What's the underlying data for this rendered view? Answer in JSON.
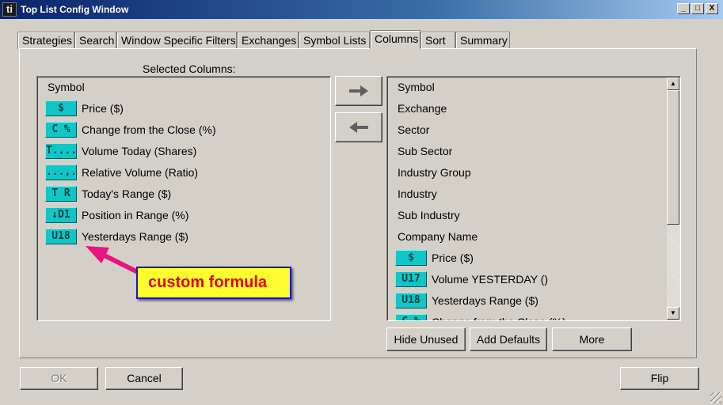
{
  "window": {
    "title": "Top List Config Window",
    "app_icon_text": "ti",
    "controls": {
      "minimize": "_",
      "maximize": "□",
      "close": "X"
    }
  },
  "tabs": [
    {
      "label": "Strategies"
    },
    {
      "label": "Search"
    },
    {
      "label": "Window Specific Filters"
    },
    {
      "label": "Exchanges"
    },
    {
      "label": "Symbol Lists"
    },
    {
      "label": "Columns",
      "active": true
    },
    {
      "label": "Sort"
    },
    {
      "label": "Summary"
    }
  ],
  "selected_columns": {
    "label": "Selected Columns:",
    "items": [
      {
        "icon": "",
        "label": "Symbol"
      },
      {
        "icon": "$",
        "label": "Price ($)"
      },
      {
        "icon": "C %",
        "label": "Change from the Close (%)"
      },
      {
        "icon": "T....l",
        "label": "Volume Today (Shares)"
      },
      {
        "icon": "...,.l|",
        "label": "Relative Volume (Ratio)"
      },
      {
        "icon": "T R",
        "label": "Today's Range ($)"
      },
      {
        "icon": "↓D1",
        "label": "Position in Range (%)"
      },
      {
        "icon": "U18",
        "label": "Yesterdays Range ($)"
      }
    ]
  },
  "available_columns": {
    "items": [
      {
        "icon": "",
        "label": "Symbol"
      },
      {
        "icon": "",
        "label": "Exchange"
      },
      {
        "icon": "",
        "label": "Sector"
      },
      {
        "icon": "",
        "label": "Sub Sector"
      },
      {
        "icon": "",
        "label": "Industry Group"
      },
      {
        "icon": "",
        "label": "Industry"
      },
      {
        "icon": "",
        "label": "Sub Industry"
      },
      {
        "icon": "",
        "label": "Company Name"
      },
      {
        "icon": "$",
        "label": "Price ($)"
      },
      {
        "icon": "U17",
        "label": "Volume YESTERDAY ()"
      },
      {
        "icon": "U18",
        "label": "Yesterdays Range ($)"
      },
      {
        "icon": "C %",
        "label": "Change from the Close (%)"
      }
    ]
  },
  "buttons": {
    "add_arrow": "→",
    "remove_arrow": "←",
    "hide_unused": "Hide Unused",
    "add_defaults": "Add Defaults",
    "more": "More",
    "ok": "OK",
    "cancel": "Cancel",
    "flip": "Flip"
  },
  "annotation": {
    "text": "custom formula"
  },
  "colors": {
    "chip": "#10c6c6",
    "callout_bg": "#ffff30",
    "callout_text": "#e00000",
    "callout_border": "#1818c8",
    "pointer": "#e8157d"
  }
}
